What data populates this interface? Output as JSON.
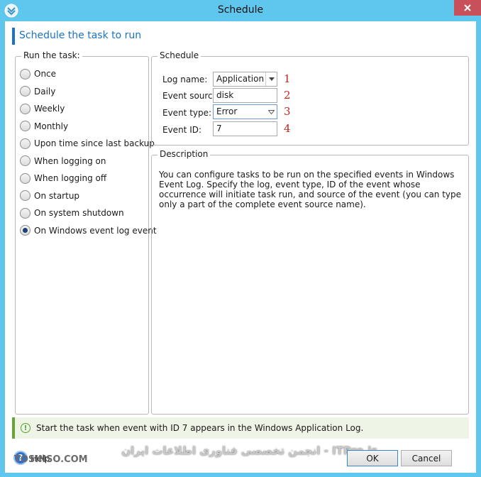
{
  "window": {
    "title": "Schedule"
  },
  "header": {
    "title": "Schedule the task to run"
  },
  "run_group": {
    "legend": "Run the task:",
    "options": [
      {
        "label": "Once",
        "checked": false
      },
      {
        "label": "Daily",
        "checked": false
      },
      {
        "label": "Weekly",
        "checked": false
      },
      {
        "label": "Monthly",
        "checked": false
      },
      {
        "label": "Upon time since last backup",
        "checked": false
      },
      {
        "label": "When logging on",
        "checked": false
      },
      {
        "label": "When logging off",
        "checked": false
      },
      {
        "label": "On startup",
        "checked": false
      },
      {
        "label": "On system shutdown",
        "checked": false
      },
      {
        "label": "On Windows event log event",
        "checked": true
      }
    ]
  },
  "schedule_group": {
    "legend": "Schedule",
    "log_name_label": "Log name:",
    "log_name_value": "Application",
    "event_source_label": "Event source:",
    "event_source_value": "disk",
    "event_type_label": "Event type:",
    "event_type_value": "Error",
    "event_id_label": "Event ID:",
    "event_id_value": "7",
    "markers": [
      "1",
      "2",
      "3",
      "4"
    ]
  },
  "description_group": {
    "legend": "Description",
    "text": "You can configure tasks to be run on the specified events in Windows Event Log. Specify the log, event type, ID of the event whose occurrence will initiate task run, and source of the event (you can type only a part of the complete event source name)."
  },
  "status": {
    "text": "Start the task when event with ID 7 appears in the Windows Application Log."
  },
  "footer": {
    "help_label": "Help",
    "ok_label": "OK",
    "cancel_label": "Cancel"
  },
  "watermark": {
    "left": "TOSINSO.COM",
    "center": "انجمن تخصصی فناوری اطلاعات ایران - ITPro.ir"
  },
  "colors": {
    "titlebar": "#5fc6ee",
    "accent": "#1a73c4",
    "close": "#c7505a",
    "marker": "#c8241c",
    "status_accent": "#65a737"
  }
}
